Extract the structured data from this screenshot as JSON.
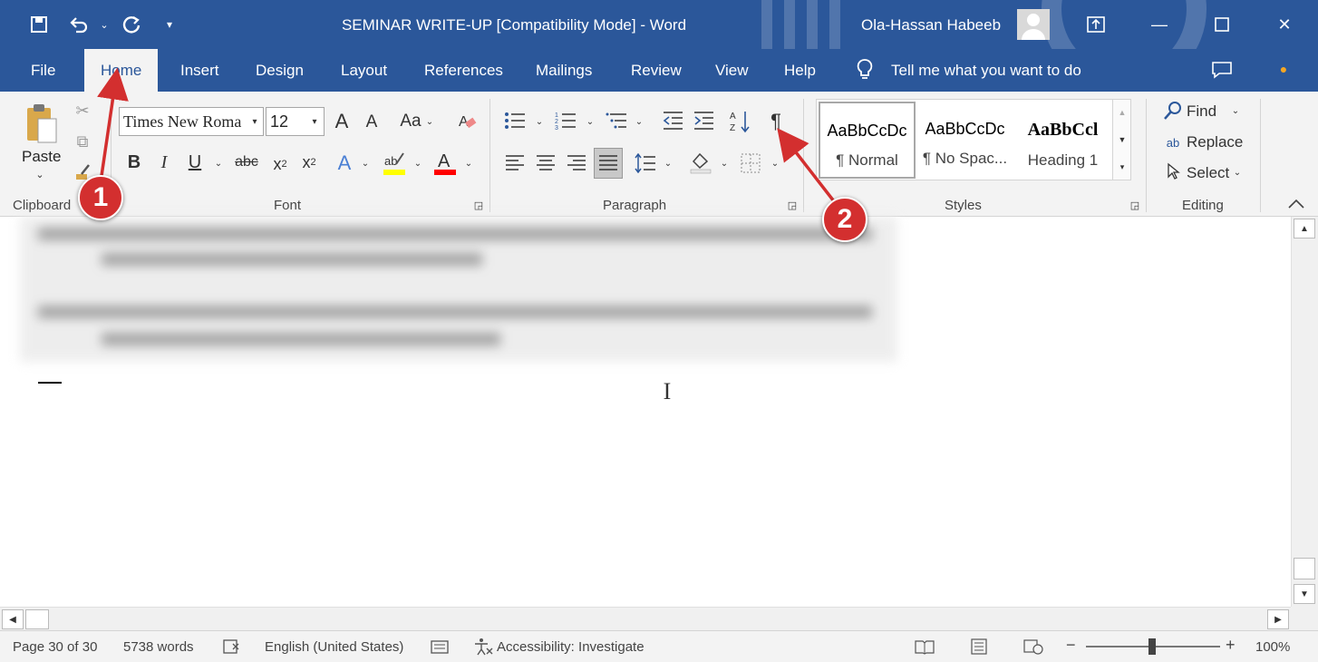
{
  "title_bar": {
    "doc_title": "SEMINAR WRITE-UP [Compatibility Mode]  -  Word",
    "user_name": "Ola-Hassan Habeeb"
  },
  "tabs": [
    "File",
    "Home",
    "Insert",
    "Design",
    "Layout",
    "References",
    "Mailings",
    "Review",
    "View",
    "Help"
  ],
  "tell_me": "Tell me what you want to do",
  "clipboard": {
    "paste": "Paste",
    "label": "Clipboard"
  },
  "font": {
    "name": "Times New Roma",
    "size": "12",
    "label": "Font",
    "bold": "B",
    "italic": "I",
    "underline": "U",
    "strike": "abc",
    "grow": "A",
    "shrink": "A",
    "case": "Aa"
  },
  "paragraph": {
    "label": "Paragraph",
    "pilcrow": "¶"
  },
  "styles": {
    "label": "Styles",
    "items": [
      {
        "preview": "AaBbCcDc",
        "name": "¶ Normal"
      },
      {
        "preview": "AaBbCcDc",
        "name": "¶ No Spac..."
      },
      {
        "preview": "AaBbCcl",
        "name": "Heading 1"
      }
    ]
  },
  "editing": {
    "label": "Editing",
    "find": "Find",
    "replace": "Replace",
    "select": "Select"
  },
  "status": {
    "page": "Page 30 of 30",
    "words": "5738 words",
    "language": "English (United States)",
    "accessibility": "Accessibility: Investigate",
    "zoom": "100%"
  },
  "callouts": [
    "1",
    "2"
  ],
  "colors": {
    "accent": "#2b579a",
    "callout": "#d32f2f",
    "highlight": "#ffff00",
    "font_color": "#ff0000"
  }
}
